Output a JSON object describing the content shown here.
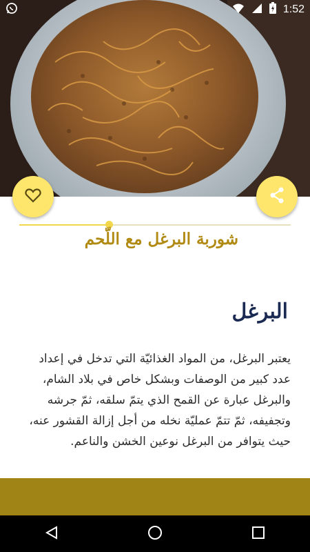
{
  "status_bar": {
    "time": "1:52",
    "icons": [
      "whatsapp-icon",
      "wifi-icon",
      "cellular-icon",
      "battery-charging-icon"
    ]
  },
  "hero": {
    "image": "bulgur-soup-with-meat-photo"
  },
  "actions": {
    "favorite_icon": "heart-outline-icon",
    "share_icon": "share-icon",
    "accent_color": "#fde66b"
  },
  "recipe": {
    "title": "شوربة البرغل مع اللّحم",
    "section_heading": "البرغل",
    "body_lines": [
      "يعتبر البرغل، من المواد الغذائيّة التي تدخل في إعداد",
      "عدد كبير من الوصفات وبشكل خاص في بلاد الشام،",
      "والبرغل عبارة عن القمح الذي يتمّ سلقه، ثمّ جرشه",
      "وتجفيفه، ثمّ تتمّ عمليّة نخله من أجل إزالة القشور عنه،",
      "حيث يتوافر من البرغل نوعين الخشن والناعم."
    ]
  },
  "colors": {
    "title": "#b08a12",
    "heading": "#1b2a52",
    "strip": "#a08516"
  },
  "nav": {
    "icons": [
      "back-icon",
      "home-icon",
      "recents-icon"
    ]
  }
}
